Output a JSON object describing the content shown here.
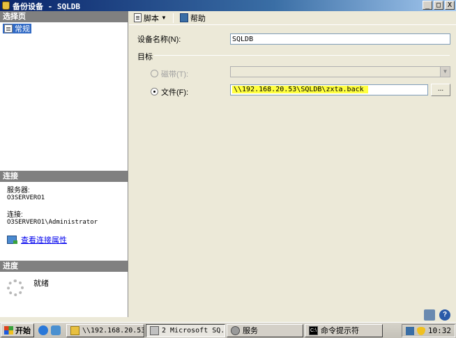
{
  "window": {
    "title": "备份设备 - SQLDB",
    "controls": {
      "minimize": "_",
      "maximize": "□",
      "close": "X"
    }
  },
  "left_pane": {
    "select_page_header": "选择页",
    "pages": [
      {
        "label": "常规",
        "selected": true
      }
    ],
    "connection_header": "连接",
    "server_label": "服务器:",
    "server_value": "O3SERVERO1",
    "connection_label": "连接:",
    "connection_value": "O3SERVERO1\\Administrator",
    "view_connection_link": "查看连接属性",
    "progress_header": "进度",
    "progress_status": "就绪"
  },
  "toolbar": {
    "script_label": "脚本",
    "help_label": "帮助"
  },
  "form": {
    "device_name_label": "设备名称(N):",
    "device_name_value": "SQLDB",
    "destination_group": "目标",
    "tape_label": "磁带(T):",
    "tape_selected": false,
    "tape_enabled": false,
    "file_label": "文件(F):",
    "file_selected": true,
    "file_value": "\\\\192.168.20.53\\SQLDB\\zxta.back",
    "browse_label": "..."
  },
  "taskbar": {
    "start_label": "开始",
    "tasks": [
      {
        "label": "\\\\192.168.20.53...",
        "icon": "folder-icon",
        "active": false
      },
      {
        "label": "2 Microsoft SQ...",
        "icon": "sql-icon",
        "active": true
      },
      {
        "label": "服务",
        "icon": "svc-icon",
        "active": false
      },
      {
        "label": "命令提示符",
        "icon": "cmd-icon",
        "active": false
      }
    ],
    "clock": "10:32"
  },
  "colors": {
    "titlebar": "#0a246a",
    "selection": "#316ac5",
    "highlight": "#ffff40",
    "section_header": "#808080"
  }
}
